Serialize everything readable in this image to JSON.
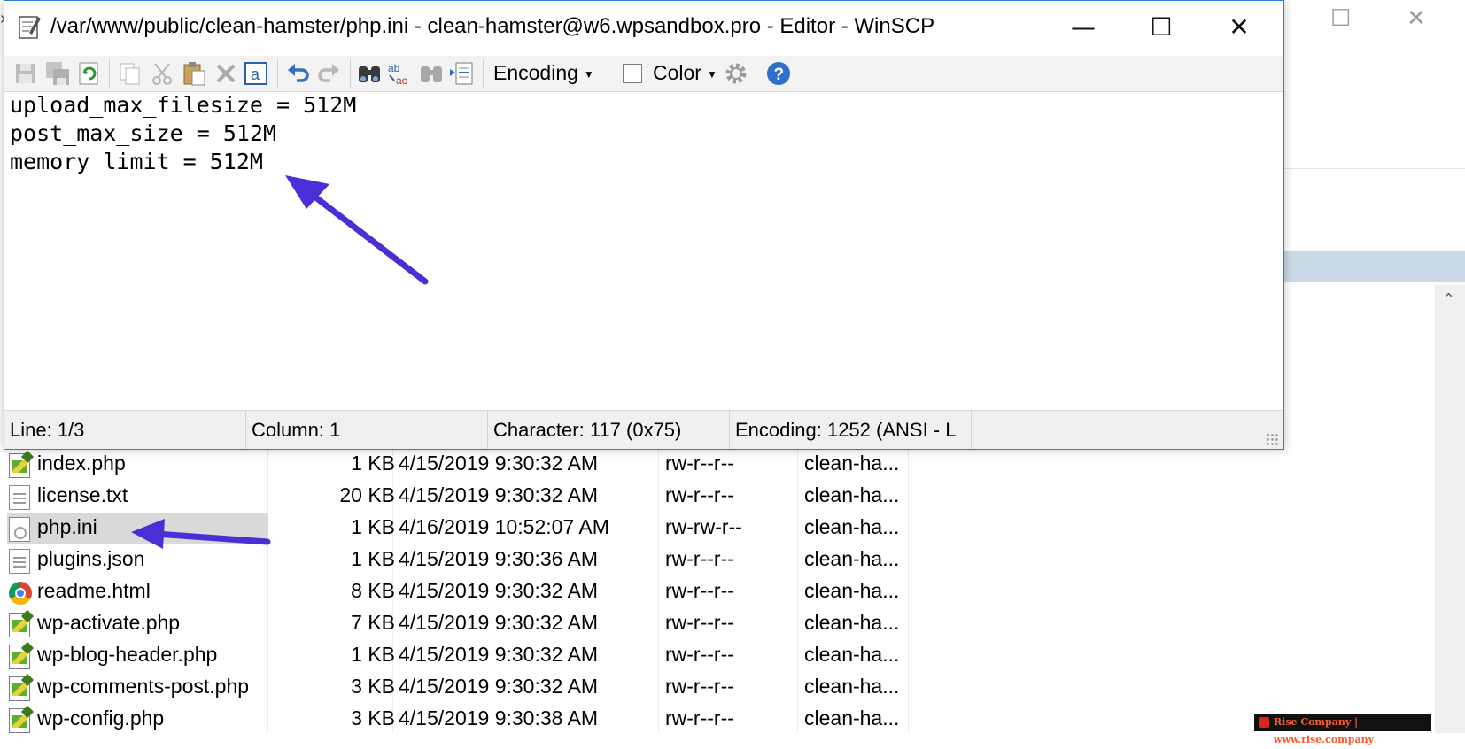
{
  "editor": {
    "title": "/var/www/public/clean-hamster/php.ini - clean-hamster@w6.wpsandbox.pro - Editor - WinSCP",
    "window_controls": {
      "minimize": "—",
      "maximize": "☐",
      "close": "✕"
    },
    "toolbar": {
      "encoding_label": "Encoding",
      "color_label": "Color",
      "icons": [
        "save-icon",
        "save-all-icon",
        "reload-icon",
        "copy-icon",
        "cut-icon",
        "paste-icon",
        "delete-icon",
        "select-all-icon",
        "undo-icon",
        "redo-icon",
        "find-icon",
        "replace-icon",
        "find-next-icon",
        "go-to-line-icon",
        "settings-icon",
        "help-icon"
      ]
    },
    "lines": [
      "upload_max_filesize = 512M",
      "post_max_size = 512M",
      "memory_limit = 512M"
    ],
    "status": {
      "line": "Line: 1/3",
      "column": "Column: 1",
      "character": "Character: 117 (0x75)",
      "encoding": "Encoding: 1252  (ANSI - L"
    }
  },
  "files": [
    {
      "name": "index.php",
      "size": "1 KB",
      "changed": "4/15/2019 9:30:32 AM",
      "rights": "rw-r--r--",
      "owner": "clean-ha...",
      "icon": "php-file-icon"
    },
    {
      "name": "license.txt",
      "size": "20 KB",
      "changed": "4/15/2019 9:30:32 AM",
      "rights": "rw-r--r--",
      "owner": "clean-ha...",
      "icon": "text-file-icon"
    },
    {
      "name": "php.ini",
      "size": "1 KB",
      "changed": "4/16/2019 10:52:07 AM",
      "rights": "rw-rw-r--",
      "owner": "clean-ha...",
      "icon": "ini-file-icon"
    },
    {
      "name": "plugins.json",
      "size": "1 KB",
      "changed": "4/15/2019 9:30:36 AM",
      "rights": "rw-r--r--",
      "owner": "clean-ha...",
      "icon": "text-file-icon"
    },
    {
      "name": "readme.html",
      "size": "8 KB",
      "changed": "4/15/2019 9:30:32 AM",
      "rights": "rw-r--r--",
      "owner": "clean-ha...",
      "icon": "chrome-icon"
    },
    {
      "name": "wp-activate.php",
      "size": "7 KB",
      "changed": "4/15/2019 9:30:32 AM",
      "rights": "rw-r--r--",
      "owner": "clean-ha...",
      "icon": "php-file-icon"
    },
    {
      "name": "wp-blog-header.php",
      "size": "1 KB",
      "changed": "4/15/2019 9:30:32 AM",
      "rights": "rw-r--r--",
      "owner": "clean-ha...",
      "icon": "php-file-icon"
    },
    {
      "name": "wp-comments-post.php",
      "size": "3 KB",
      "changed": "4/15/2019 9:30:32 AM",
      "rights": "rw-r--r--",
      "owner": "clean-ha...",
      "icon": "php-file-icon"
    },
    {
      "name": "wp-config.php",
      "size": "3 KB",
      "changed": "4/15/2019 9:30:38 AM",
      "rights": "rw-r--r--",
      "owner": "clean-ha...",
      "icon": "php-file-icon"
    }
  ],
  "selected_file_index": 2,
  "background_window_controls": {
    "maximize": "☐",
    "close": "✕"
  },
  "watermark": "Rise Company | www.rise.company",
  "colors": {
    "accent_border": "#2b7fd6",
    "annotation_arrow": "#4a2fd6",
    "selection": "#d9d9d9"
  }
}
